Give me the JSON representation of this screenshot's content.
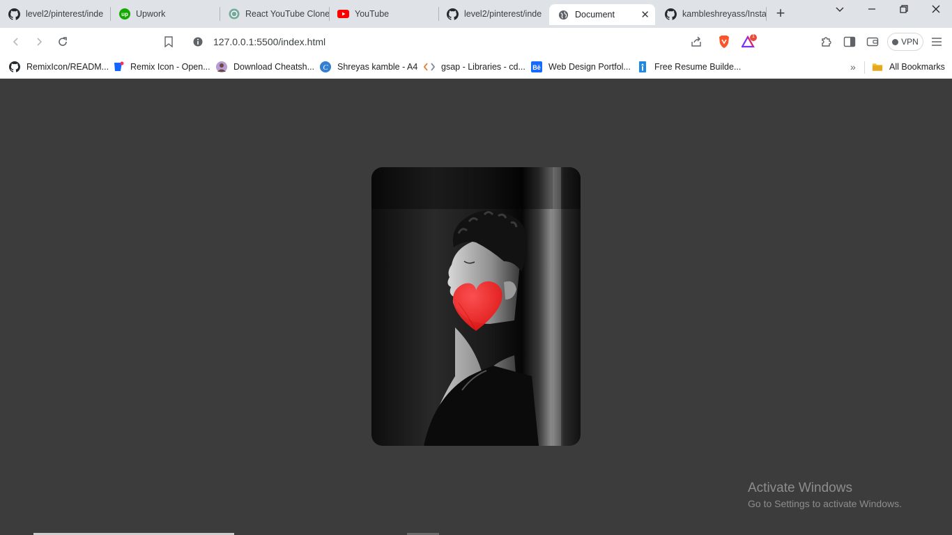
{
  "browser": {
    "tabs": [
      {
        "title": "level2/pinterest/inde",
        "icon": "github-icon"
      },
      {
        "title": "Upwork",
        "icon": "upwork-icon"
      },
      {
        "title": "React YouTube Clone",
        "icon": "chatgpt-icon"
      },
      {
        "title": "YouTube",
        "icon": "youtube-icon"
      },
      {
        "title": "level2/pinterest/inde",
        "icon": "github-icon"
      },
      {
        "title": "Document",
        "icon": "globe-icon",
        "active": true
      },
      {
        "title": "kambleshreyass/Insta",
        "icon": "github-icon"
      }
    ],
    "url": "127.0.0.1:5500/index.html",
    "vpn_label": "VPN",
    "notification_count": "1",
    "bookmarks": [
      {
        "label": "RemixIcon/READM...",
        "icon": "github-icon"
      },
      {
        "label": "Remix Icon - Open...",
        "icon": "remix-icon"
      },
      {
        "label": "Download Cheatsh...",
        "icon": "avatar-icon"
      },
      {
        "label": "Shreyas kamble - A4",
        "icon": "canva-icon"
      },
      {
        "label": "gsap - Libraries - cd...",
        "icon": "code-icon"
      },
      {
        "label": "Web Design Portfol...",
        "icon": "behance-icon"
      },
      {
        "label": "Free Resume Builde...",
        "icon": "resume-icon"
      }
    ],
    "all_bookmarks_label": "All Bookmarks"
  },
  "page": {
    "background": "#3c3c3c",
    "photo": {
      "subject": "black and white portrait",
      "overlay_icon": "heart-icon",
      "overlay_color": "#ff1f1f"
    }
  },
  "system": {
    "watermark_title": "Activate Windows",
    "watermark_subtitle": "Go to Settings to activate Windows."
  }
}
